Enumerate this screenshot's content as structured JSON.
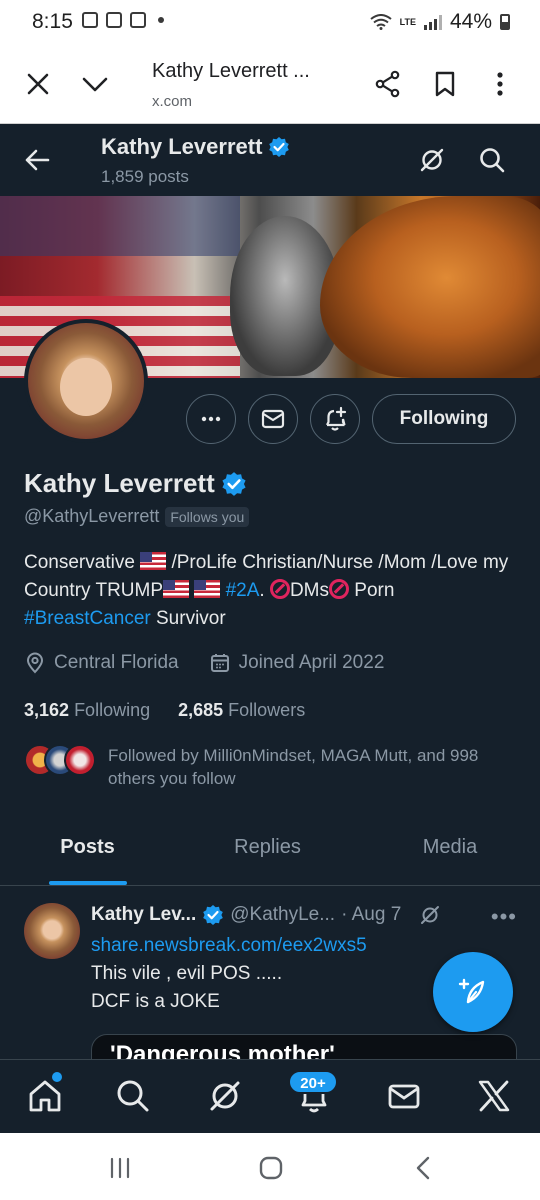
{
  "status_bar": {
    "time": "8:15",
    "battery": "44%",
    "network": "LTE"
  },
  "browser": {
    "title": "Kathy Leverrett ...",
    "url": "x.com"
  },
  "header": {
    "name": "Kathy Leverrett",
    "posts_count": "1,859 posts"
  },
  "profile": {
    "name": "Kathy Leverrett",
    "handle": "@KathyLeverrett",
    "follows_you": "Follows you",
    "following_button": "Following",
    "bio": {
      "part1": "Conservative ",
      "part2": " /ProLife Christian/Nurse /Mom /Love my Country TRUMP",
      "hashtag1": "#2A",
      "part3": ". ",
      "part4": "DMs",
      "part5": " Porn ",
      "hashtag2": "#BreastCancer",
      "part6": " Survivor"
    },
    "location": "Central Florida",
    "joined": "Joined April 2022",
    "following_count": "3,162",
    "following_label": "Following",
    "followers_count": "2,685",
    "followers_label": "Followers",
    "followed_by": "Followed by Milli0nMindset, MAGA Mutt, and 998 others you follow"
  },
  "tabs": [
    {
      "label": "Posts",
      "active": true
    },
    {
      "label": "Replies",
      "active": false
    },
    {
      "label": "Media",
      "active": false
    }
  ],
  "post": {
    "name": "Kathy Lev...",
    "handle": "@KathyLe...",
    "date": "· Aug 7",
    "link": "share.newsbreak.com/eex2wxs5",
    "line1": "This vile , evil POS .....",
    "line2": "DCF is a JOKE",
    "card_title": "'Dangerous mother'"
  },
  "bottom_nav": {
    "notifications_badge": "20+"
  },
  "colors": {
    "background": "#15202b",
    "accent": "#1d9bf0",
    "text_primary": "#e7e9ea",
    "text_secondary": "#8b98a5",
    "border": "#38444d"
  },
  "icons": [
    "close-icon",
    "chevron-down-icon",
    "share-icon",
    "bookmark-icon",
    "more-vertical-icon",
    "back-arrow-icon",
    "verified-badge-icon",
    "grok-icon",
    "search-icon",
    "more-horizontal-icon",
    "mail-icon",
    "notification-bell-plus-icon",
    "location-pin-icon",
    "calendar-icon",
    "compose-feather-icon",
    "home-icon",
    "bell-icon",
    "x-logo-icon"
  ]
}
